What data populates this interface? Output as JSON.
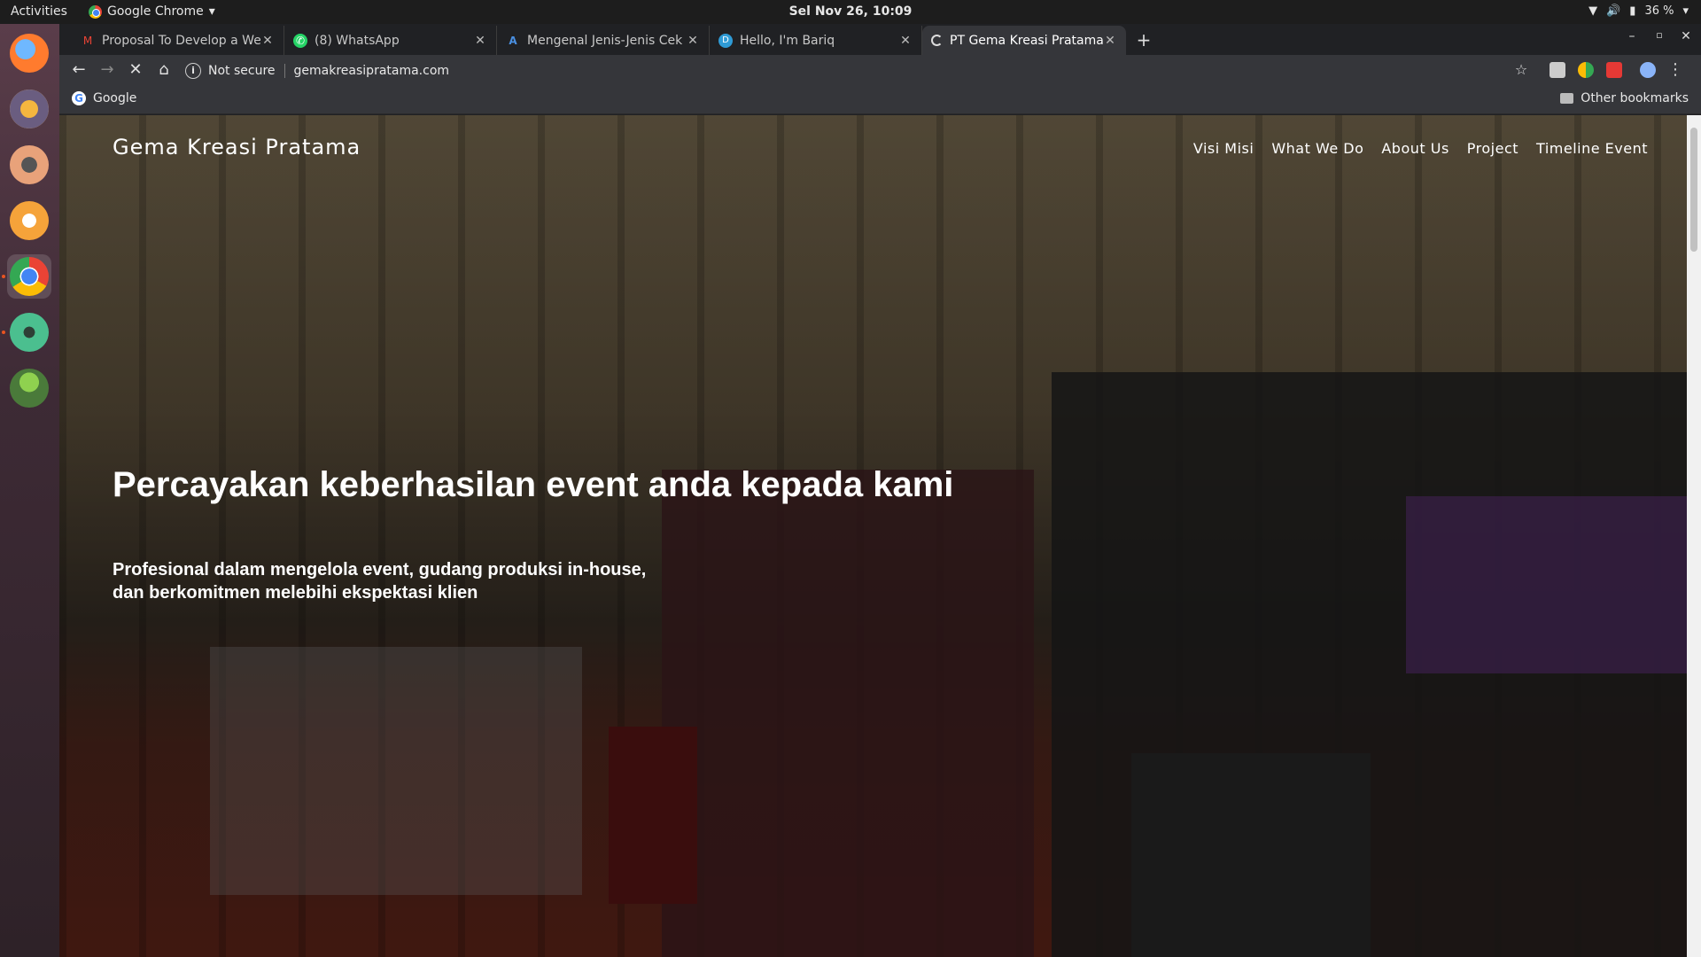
{
  "system": {
    "activities": "Activities",
    "app_name": "Google Chrome",
    "clock": "Sel Nov 26, 10:09",
    "battery": "36 %"
  },
  "browser": {
    "tabs": [
      {
        "title": "Proposal To Develop a We",
        "icon": "gmail-icon"
      },
      {
        "title": "(8) WhatsApp",
        "icon": "whatsapp-icon"
      },
      {
        "title": "Mengenal Jenis-Jenis Cek",
        "icon": "site-icon"
      },
      {
        "title": "Hello, I'm Bariq",
        "icon": "site-icon"
      },
      {
        "title": "PT Gema Kreasi Pratama",
        "icon": "loading-icon"
      }
    ],
    "security_label": "Not secure",
    "url": "gemakreasipratama.com",
    "bookmarks": [
      {
        "label": "Google"
      }
    ],
    "other_bookmarks": "Other bookmarks"
  },
  "page": {
    "brand": "Gema Kreasi Pratama",
    "nav": [
      "Visi Misi",
      "What We Do",
      "About Us",
      "Project",
      "Timeline Event"
    ],
    "headline": "Percayakan keberhasilan event anda kepada kami",
    "subtitle_line1": "Profesional dalam mengelola event, gudang produksi in-house,",
    "subtitle_line2": "dan berkomitmen melebihi ekspektasi klien"
  }
}
